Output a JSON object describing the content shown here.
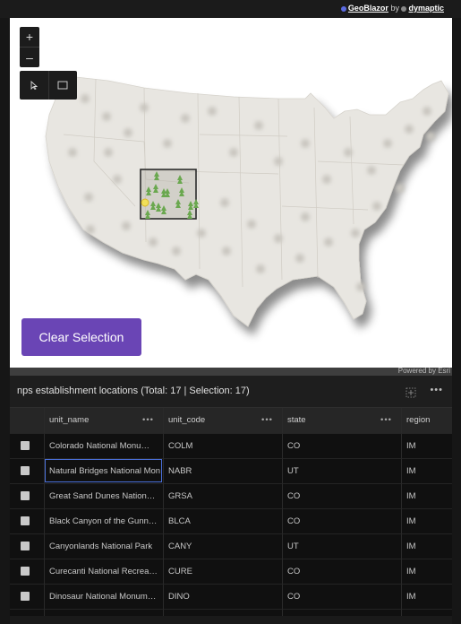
{
  "credit": {
    "product": "GeoBlazor",
    "by": "by",
    "company": "dymaptic"
  },
  "map": {
    "zoom_in": "+",
    "zoom_out": "–",
    "clear_selection": "Clear Selection",
    "attribution": "Powered by Esri",
    "colors": {
      "land": "#e8e6e1",
      "marker": "#6aa84f",
      "selected_marker": "#f1e05a",
      "selection_box": "#2b2b2b",
      "button": "#6a45b5"
    }
  },
  "table": {
    "title": "nps establishment locations (Total: 17 | Selection: 17)",
    "columns": [
      "unit_name",
      "unit_code",
      "state",
      "region"
    ],
    "rows": [
      [
        "Colorado National Monu…",
        "COLM",
        "CO",
        "IM"
      ],
      [
        "Natural Bridges National Mon",
        "NABR",
        "UT",
        "IM"
      ],
      [
        "Great Sand Dunes Nation…",
        "GRSA",
        "CO",
        "IM"
      ],
      [
        "Black Canyon of the Gunn…",
        "BLCA",
        "CO",
        "IM"
      ],
      [
        "Canyonlands National Park",
        "CANY",
        "UT",
        "IM"
      ],
      [
        "Curecanti National Recrea…",
        "CURE",
        "CO",
        "IM"
      ],
      [
        "Dinosaur National Monum…",
        "DINO",
        "CO",
        "IM"
      ]
    ]
  }
}
